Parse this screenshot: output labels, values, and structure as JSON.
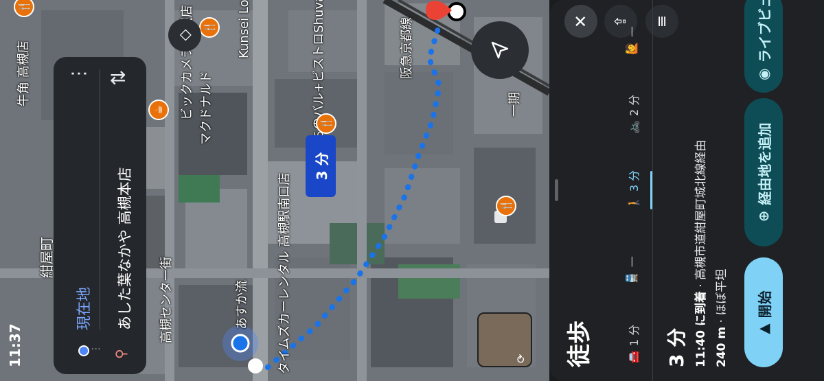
{
  "status_bar": {
    "time": "11:37"
  },
  "map": {
    "labels": {
      "konya": "紺屋町",
      "center_street": "高槻センター街",
      "mcdonalds": "マクドナルド",
      "bistro": "まちのバル+ビストロShuvaMoo",
      "kunsei": "Kunsei Love",
      "bic": "ビックカメラ 高槻店",
      "rental": "タイムズカーレンタル 高槻駅南口店",
      "asuryu": "あすか流",
      "hankyu": "阪急京都線",
      "gyukaku": "牛角 高槻店",
      "ichigo": "一期"
    },
    "route_bubble": "3 分"
  },
  "route_card": {
    "origin": "現在地",
    "destination": "あした葉なかや 高槻本店",
    "more_icon": "more-vert-icon",
    "swap_icon": "swap-icon"
  },
  "sheet": {
    "mode_title": "徒歩",
    "close_icon": "close-icon",
    "tabs": [
      {
        "icon": "car-icon",
        "label": "1 分"
      },
      {
        "icon": "transit-icon",
        "label": "—"
      },
      {
        "icon": "walk-icon",
        "label": "3 分"
      },
      {
        "icon": "bike-icon",
        "label": "2 分"
      },
      {
        "icon": "ride-icon",
        "label": "—"
      }
    ],
    "eta_minutes": "3 分",
    "arrival_bold": "11:40 に到着",
    "arrival_via": " · 高槻市道紺屋町城北線経由",
    "distance_bold": "240 m",
    "distance_note": " · ほぼ平坦",
    "start_button": "開始",
    "add_waypoint_button": "経由地を追加",
    "live_view_button": "ライブビュー"
  },
  "colors": {
    "route_blue": "#1a73e8",
    "accent_cyan": "#7fd1f5",
    "poi_orange": "#e8710a",
    "destination_red": "#ea4335"
  }
}
